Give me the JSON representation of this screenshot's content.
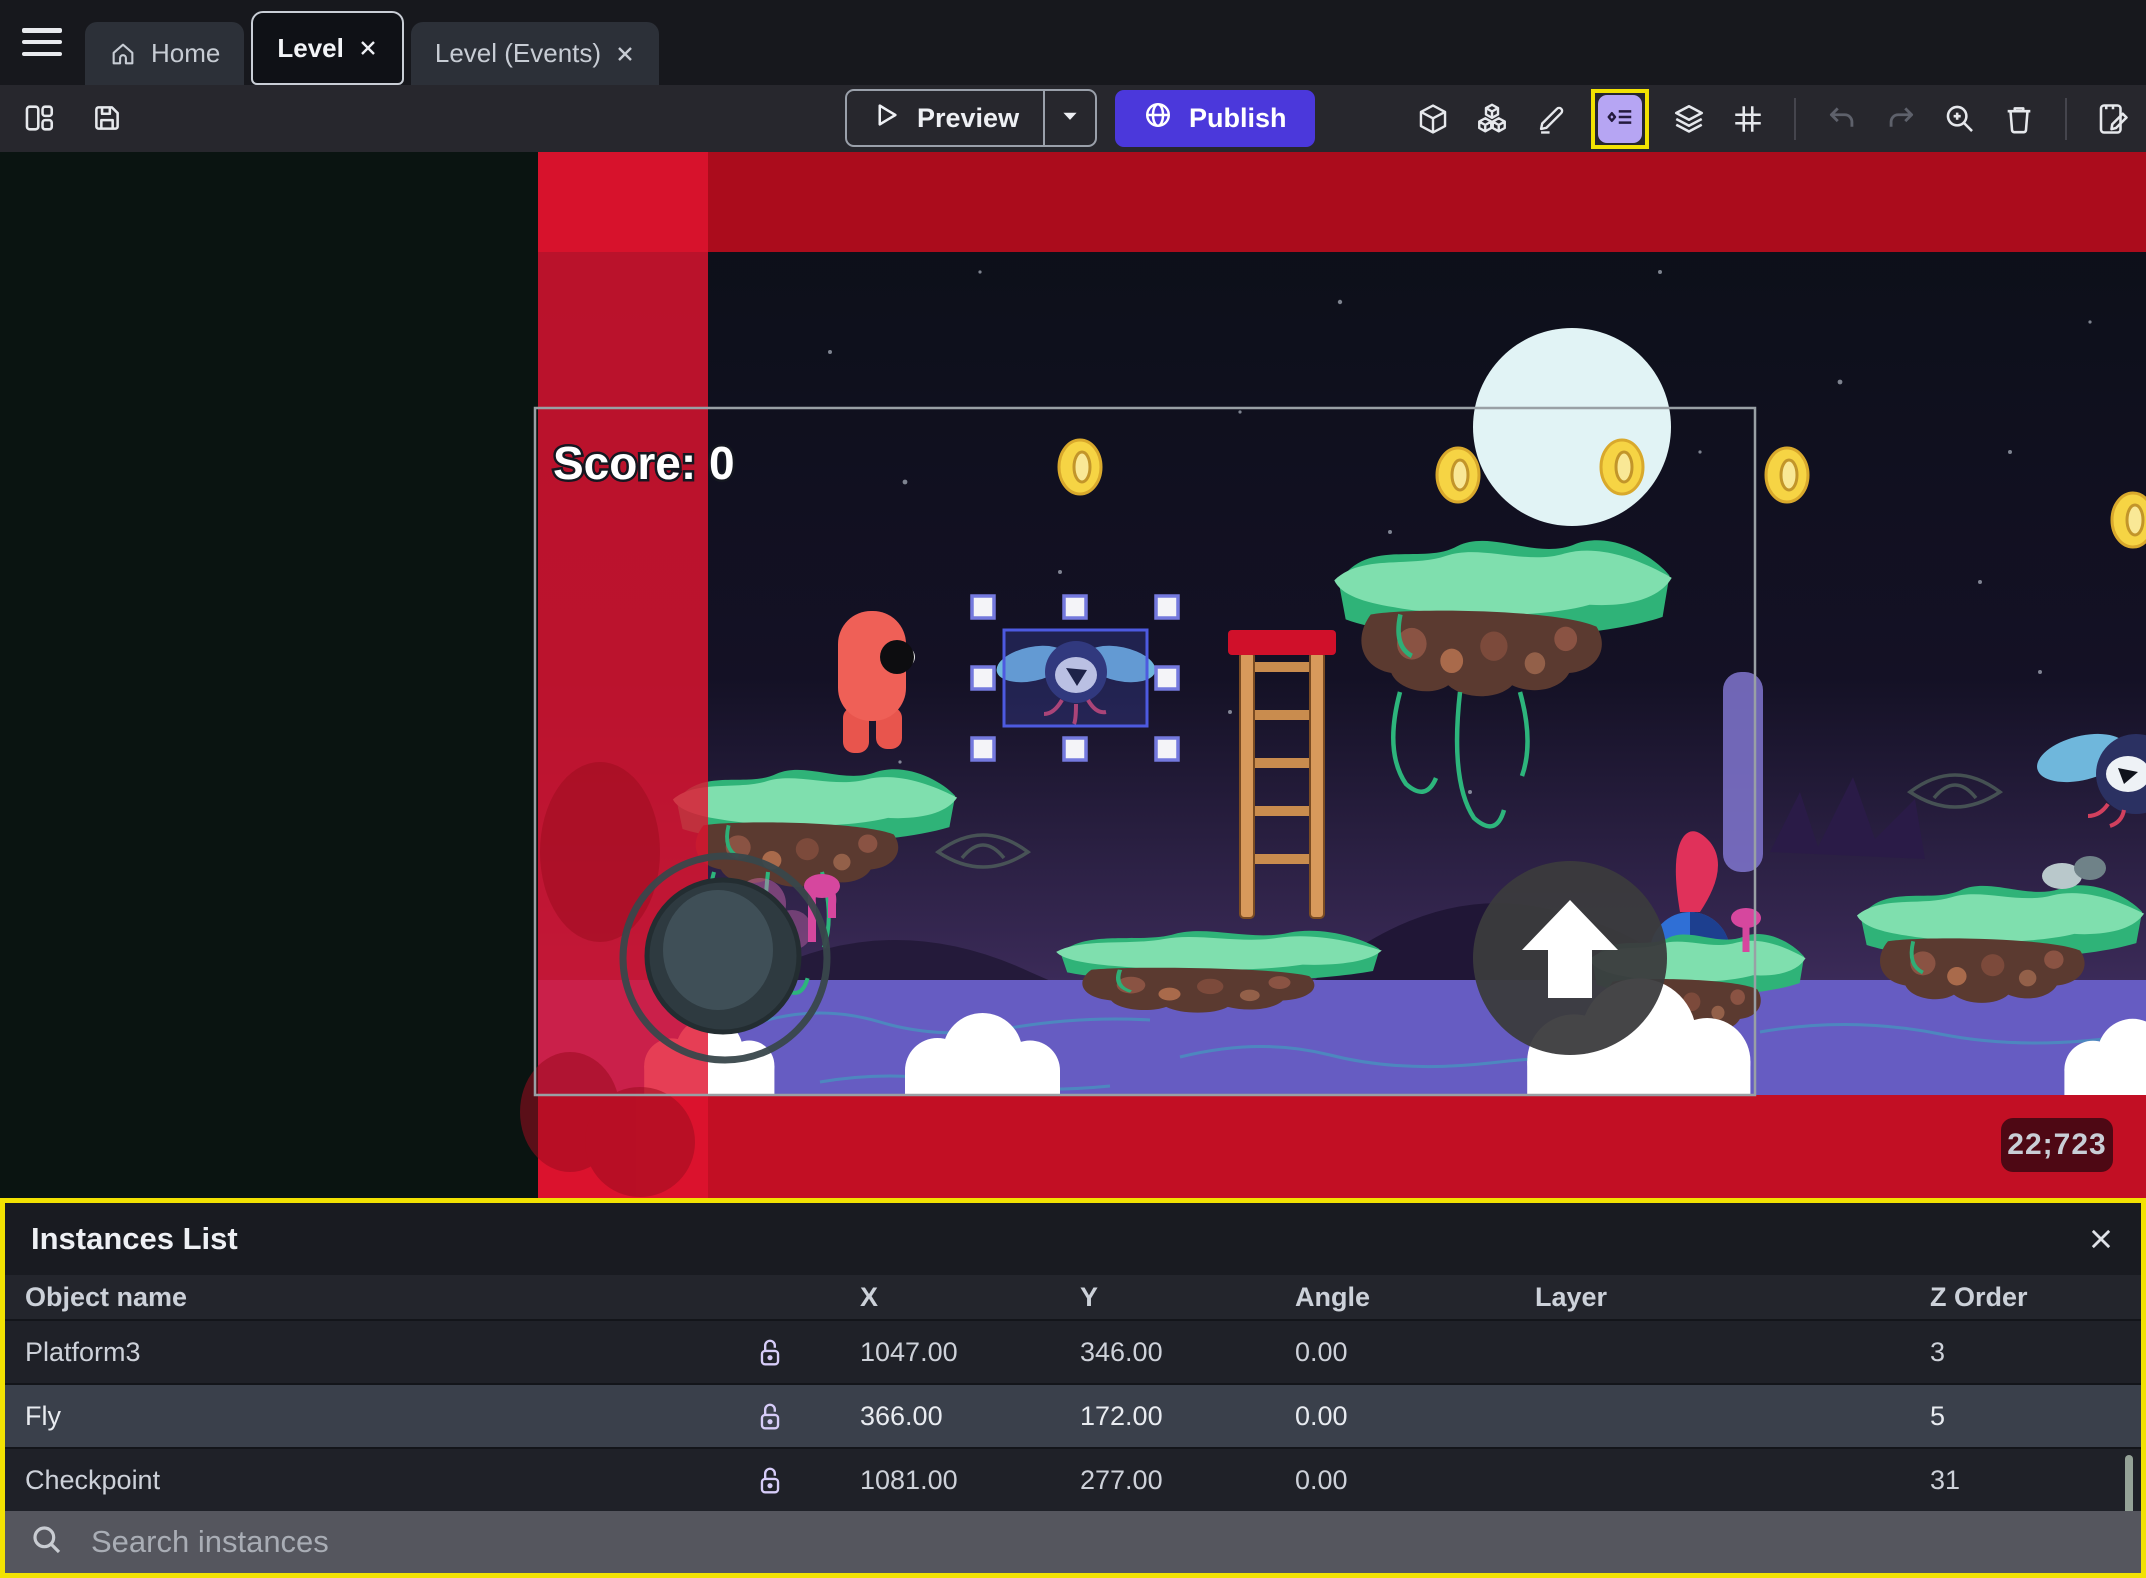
{
  "window": {
    "tabs": [
      {
        "label": "Home",
        "active": false
      },
      {
        "label": "Level",
        "active": true
      },
      {
        "label": "Level (Events)",
        "active": false
      }
    ]
  },
  "toolbar": {
    "preview_label": "Preview",
    "publish_label": "Publish",
    "icons": [
      "panels-layout-icon",
      "save-icon",
      "play-icon",
      "caret-down-icon",
      "globe-icon",
      "objects-cube-icon",
      "object-groups-icon",
      "edit-pencil-icon",
      "instances-list-icon",
      "layers-icon",
      "grid-icon",
      "undo-icon",
      "redo-icon",
      "zoom-in-icon",
      "trash-icon",
      "scene-properties-icon"
    ]
  },
  "canvas": {
    "score_label": "Score: 0",
    "coords_badge": "22;723"
  },
  "instances_panel": {
    "title": "Instances List",
    "columns": [
      "Object name",
      "X",
      "Y",
      "Angle",
      "Layer",
      "Z Order"
    ],
    "rows": [
      {
        "name": "Platform3",
        "x": "1047.00",
        "y": "346.00",
        "angle": "0.00",
        "layer": "",
        "z_order": "3",
        "selected": false
      },
      {
        "name": "Fly",
        "x": "366.00",
        "y": "172.00",
        "angle": "0.00",
        "layer": "",
        "z_order": "5",
        "selected": true
      },
      {
        "name": "Checkpoint",
        "x": "1081.00",
        "y": "277.00",
        "angle": "0.00",
        "layer": "",
        "z_order": "31",
        "selected": false
      }
    ],
    "search_placeholder": "Search instances"
  },
  "colors": {
    "publish_purple": "#4B38DB",
    "highlight_yellow": "#F2E202",
    "selection_blue": "#7479DE",
    "stripe_red": "#D81330",
    "icon_lavender": "#B6A5F3"
  }
}
